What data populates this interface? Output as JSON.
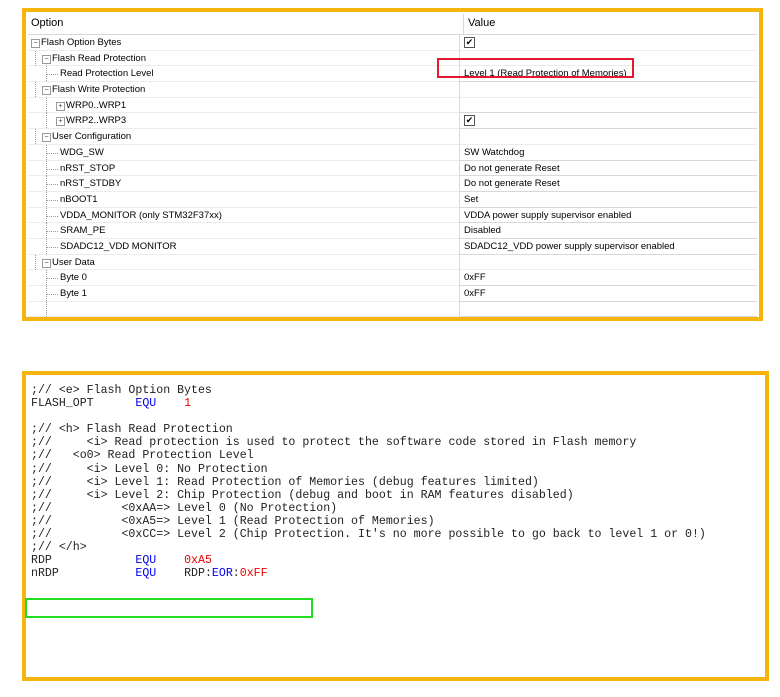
{
  "grid": {
    "header": {
      "option": "Option",
      "value": "Value"
    },
    "rows": [
      {
        "label": "Flash Option Bytes",
        "value": "",
        "checkbox": true,
        "level": 0,
        "expander": "−"
      },
      {
        "label": "Flash Read Protection",
        "value": "",
        "checkbox": false,
        "level": 1,
        "expander": "−"
      },
      {
        "label": "Read Protection Level",
        "value": "Level 1 (Read Protection of Memories)",
        "checkbox": false,
        "level": 2,
        "expander": ""
      },
      {
        "label": "Flash Write Protection",
        "value": "",
        "checkbox": false,
        "level": 1,
        "expander": "−"
      },
      {
        "label": "WRP0..WRP1",
        "value": "",
        "checkbox": false,
        "level": 2,
        "expander": "+"
      },
      {
        "label": "WRP2..WRP3",
        "value": "",
        "checkbox": true,
        "level": 2,
        "expander": "+"
      },
      {
        "label": "User Configuration",
        "value": "",
        "checkbox": false,
        "level": 1,
        "expander": "−"
      },
      {
        "label": "WDG_SW",
        "value": "SW Watchdog",
        "checkbox": false,
        "level": 2,
        "expander": ""
      },
      {
        "label": "nRST_STOP",
        "value": "Do not generate Reset",
        "checkbox": false,
        "level": 2,
        "expander": ""
      },
      {
        "label": "nRST_STDBY",
        "value": "Do not generate Reset",
        "checkbox": false,
        "level": 2,
        "expander": ""
      },
      {
        "label": "nBOOT1",
        "value": "Set",
        "checkbox": false,
        "level": 2,
        "expander": ""
      },
      {
        "label": "VDDA_MONITOR (only STM32F37xx)",
        "value": "VDDA power supply supervisor enabled",
        "checkbox": false,
        "level": 2,
        "expander": ""
      },
      {
        "label": "SRAM_PE",
        "value": "Disabled",
        "checkbox": false,
        "level": 2,
        "expander": ""
      },
      {
        "label": "SDADC12_VDD MONITOR",
        "value": "SDADC12_VDD power supply supervisor enabled",
        "checkbox": false,
        "level": 2,
        "expander": ""
      },
      {
        "label": "User Data",
        "value": "",
        "checkbox": false,
        "level": 1,
        "expander": "−"
      },
      {
        "label": "Byte 0",
        "value": "0xFF",
        "checkbox": false,
        "level": 2,
        "expander": ""
      },
      {
        "label": "Byte 1",
        "value": "0xFF",
        "checkbox": false,
        "level": 2,
        "expander": ""
      },
      {
        "label": "",
        "value": "",
        "checkbox": false,
        "level": 2,
        "expander": ""
      }
    ],
    "checkmark": "✔"
  },
  "code": {
    "lines": [
      {
        "segments": [
          {
            "t": ";// <e> Flash Option Bytes",
            "c": ""
          }
        ]
      },
      {
        "segments": [
          {
            "t": "FLASH_OPT      ",
            "c": ""
          },
          {
            "t": "EQU",
            "c": "kw"
          },
          {
            "t": "    ",
            "c": ""
          },
          {
            "t": "1",
            "c": "num"
          }
        ]
      },
      {
        "segments": [
          {
            "t": "",
            "c": ""
          }
        ]
      },
      {
        "segments": [
          {
            "t": ";// <h> Flash Read Protection",
            "c": ""
          }
        ]
      },
      {
        "segments": [
          {
            "t": ";//     <i> Read protection is used to protect the software code stored in Flash memory",
            "c": ""
          }
        ]
      },
      {
        "segments": [
          {
            "t": ";//   <o0> Read Protection Level",
            "c": ""
          }
        ]
      },
      {
        "segments": [
          {
            "t": ";//     <i> Level 0: No Protection",
            "c": ""
          }
        ]
      },
      {
        "segments": [
          {
            "t": ";//     <i> Level 1: Read Protection of Memories (debug features limited)",
            "c": ""
          }
        ]
      },
      {
        "segments": [
          {
            "t": ";//     <i> Level 2: Chip Protection (debug and boot in RAM features disabled)",
            "c": ""
          }
        ]
      },
      {
        "segments": [
          {
            "t": ";//          <0xAA=> Level 0 (No Protection)",
            "c": ""
          }
        ]
      },
      {
        "segments": [
          {
            "t": ";//          <0xA5=> Level 1 (Read Protection of Memories)",
            "c": ""
          }
        ]
      },
      {
        "segments": [
          {
            "t": ";//          <0xCC=> Level 2 (Chip Protection. It's no more possible to go back to level 1 or 0!)",
            "c": ""
          }
        ]
      },
      {
        "segments": [
          {
            "t": ";// </h>",
            "c": ""
          }
        ]
      },
      {
        "segments": [
          {
            "t": "RDP            ",
            "c": ""
          },
          {
            "t": "EQU",
            "c": "kw"
          },
          {
            "t": "    ",
            "c": ""
          },
          {
            "t": "0xA5",
            "c": "num"
          }
        ]
      },
      {
        "segments": [
          {
            "t": "nRDP           ",
            "c": ""
          },
          {
            "t": "EQU",
            "c": "kw"
          },
          {
            "t": "    RDP:",
            "c": ""
          },
          {
            "t": "EOR",
            "c": "kw"
          },
          {
            "t": ":",
            "c": ""
          },
          {
            "t": "0xFF",
            "c": "num"
          }
        ]
      }
    ]
  },
  "colors": {
    "panel_border": "#f5b50d",
    "highlight_red": "#e3192d",
    "highlight_green": "#22dd22",
    "keyword": "#0000ee",
    "number": "#ee0000"
  }
}
